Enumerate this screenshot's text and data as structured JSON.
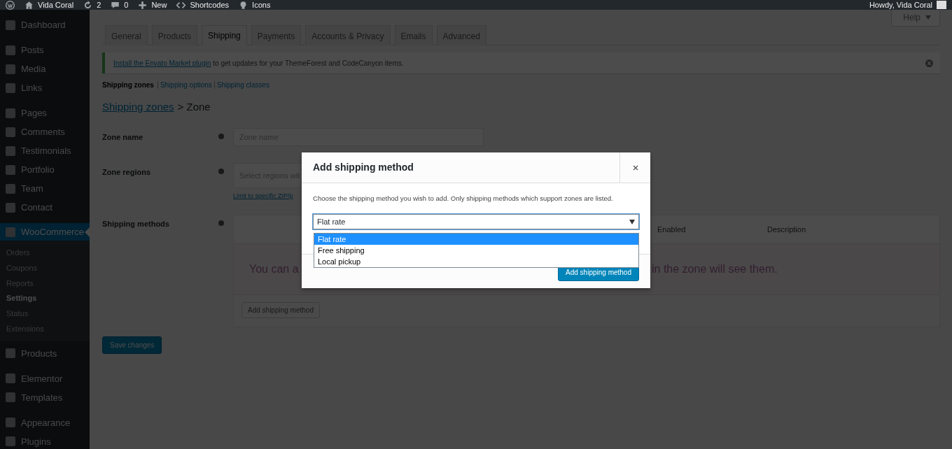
{
  "admin_bar": {
    "items": [
      {
        "kind": "logo"
      },
      {
        "kind": "home",
        "label": "Vida Coral"
      },
      {
        "kind": "updates",
        "label": "2"
      },
      {
        "kind": "comments",
        "label": "0"
      },
      {
        "kind": "new",
        "label": "New"
      },
      {
        "kind": "shortcodes",
        "label": "Shortcodes"
      },
      {
        "kind": "bulb",
        "label": "Icons"
      }
    ],
    "greeting": "Howdy, Vida Coral"
  },
  "sidebar": {
    "items": [
      {
        "label": "Dashboard",
        "selected": false
      },
      {
        "label": "Posts",
        "selected": false
      },
      {
        "label": "Media",
        "selected": false
      },
      {
        "label": "Links",
        "selected": false
      },
      {
        "label": "Pages",
        "selected": false
      },
      {
        "label": "Comments",
        "selected": false
      },
      {
        "label": "Testimonials",
        "selected": false
      },
      {
        "label": "Portfolio",
        "selected": false
      },
      {
        "label": "Team",
        "selected": false
      },
      {
        "label": "Contact",
        "selected": false
      },
      {
        "label": "WooCommerce",
        "selected": true,
        "children": [
          {
            "label": "Orders",
            "selected": false
          },
          {
            "label": "Coupons",
            "selected": false
          },
          {
            "label": "Reports",
            "selected": false
          },
          {
            "label": "Settings",
            "selected": true
          },
          {
            "label": "Status",
            "selected": false
          },
          {
            "label": "Extensions",
            "selected": false
          }
        ]
      },
      {
        "label": "Products",
        "selected": false
      },
      {
        "label": "Elementor",
        "selected": false
      },
      {
        "label": "Templates",
        "selected": false
      },
      {
        "label": "Appearance",
        "selected": false
      },
      {
        "label": "Plugins",
        "selected": false
      }
    ]
  },
  "help": {
    "label": "Help"
  },
  "tabs": [
    {
      "label": "General",
      "selected": false
    },
    {
      "label": "Products",
      "selected": false
    },
    {
      "label": "Shipping",
      "selected": true
    },
    {
      "label": "Payments",
      "selected": false
    },
    {
      "label": "Accounts & Privacy",
      "selected": false
    },
    {
      "label": "Emails",
      "selected": false
    },
    {
      "label": "Advanced",
      "selected": false
    }
  ],
  "notice": {
    "link": "Install the Envato Market plugin",
    "text": "to get updates for your ThemeForest and CodeCanyon items."
  },
  "subnav": [
    {
      "label": "Shipping zones",
      "selected": true
    },
    {
      "label": "Shipping options",
      "selected": false
    },
    {
      "label": "Shipping classes",
      "selected": false
    }
  ],
  "breadcrumb": {
    "link": "Shipping zones",
    "current": "> Zone"
  },
  "fields": [
    {
      "label": "Zone name",
      "placeholder": "Zone name"
    },
    {
      "label": "Zone regions",
      "placeholder": "Select regions wit",
      "link": "Limit to specific ZIP/p"
    }
  ],
  "shipping_methods": {
    "label": "Shipping methods",
    "columns": [
      "Enabled",
      "Description"
    ],
    "empty_text_start": "You can a",
    "empty_text_end": "in the zone will see them.",
    "button": "Add shipping method"
  },
  "save_button": {
    "label": "Save changes"
  },
  "modal": {
    "title": "Add shipping method",
    "description": "Choose the shipping method you wish to add. Only shipping methods which support zones are listed.",
    "select": {
      "value": "Flat rate",
      "options": [
        {
          "label": "Flat rate",
          "selected": true
        },
        {
          "label": "Free shipping",
          "selected": false
        },
        {
          "label": "Local pickup",
          "selected": false
        }
      ]
    },
    "button": "Add shipping method"
  }
}
